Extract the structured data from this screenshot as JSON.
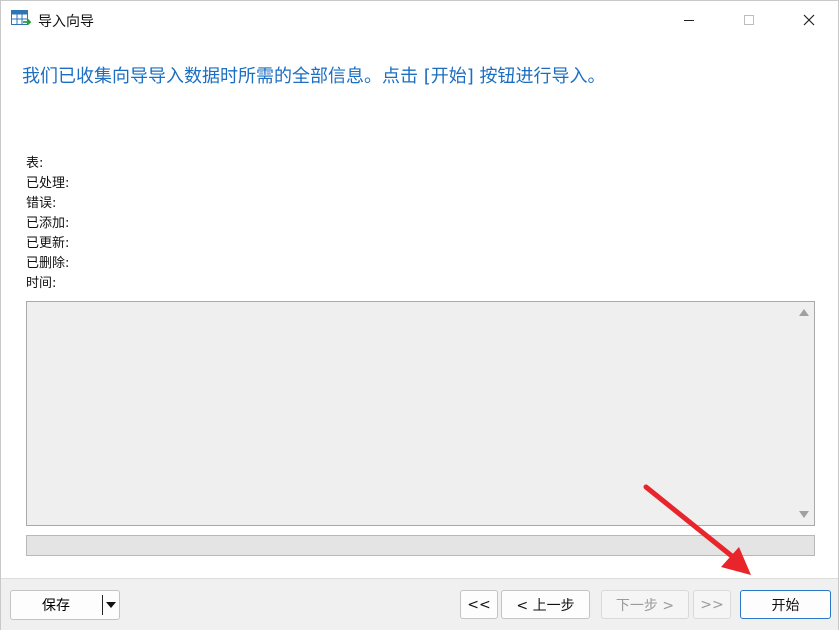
{
  "window": {
    "title": "导入向导"
  },
  "heading": "我们已收集向导导入数据时所需的全部信息。点击 [开始] 按钮进行导入。",
  "stats": [
    {
      "label": "表:"
    },
    {
      "label": "已处理:"
    },
    {
      "label": "错误:"
    },
    {
      "label": "已添加:"
    },
    {
      "label": "已更新:"
    },
    {
      "label": "已删除:"
    },
    {
      "label": "时间:"
    }
  ],
  "progress": {
    "value_percent": 0
  },
  "footer": {
    "save_label": "保存",
    "first_label": "<<",
    "prev_label": "< 上一步",
    "next_label": "下一步 >",
    "last_label": ">>",
    "start_label": "开始"
  },
  "colors": {
    "heading": "#1b6ec2",
    "annotation_arrow": "#e8252a",
    "progress_fill": "#06b025"
  }
}
